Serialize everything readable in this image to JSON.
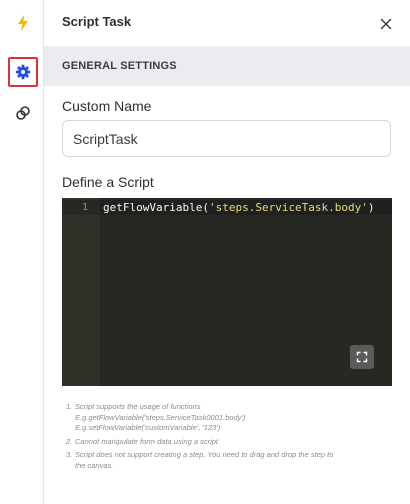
{
  "rail": {
    "items": [
      {
        "icon": "lightning-bolt-icon",
        "color": "#f5b800"
      },
      {
        "icon": "gear-icon",
        "color": "#1f4fd6",
        "selected": true
      },
      {
        "icon": "link-icon",
        "color": "#333333"
      }
    ]
  },
  "panel": {
    "title": "Script Task",
    "close_icon": "close-icon"
  },
  "section": {
    "title": "GENERAL SETTINGS"
  },
  "custom_name": {
    "label": "Custom Name",
    "value": "ScriptTask"
  },
  "script": {
    "label": "Define a Script",
    "line_number": "1",
    "code_func": "getFlowVariable(",
    "code_string": "'steps.ServiceTask.body'",
    "code_close": ")",
    "fullscreen_icon": "fullscreen-icon"
  },
  "notes": [
    {
      "num": "1.",
      "lines": [
        "Script supports the usage of functions",
        "E.g.getFlowVariable('steps.ServiceTask0001.body')",
        "E.g.setFlowVariable('customVariable', '123')"
      ]
    },
    {
      "num": "2.",
      "lines": [
        "Cannot manipulate form data using a script"
      ]
    },
    {
      "num": "3.",
      "lines": [
        "Script does not support creating a step, You need to drag and drop the step to",
        "the canvas."
      ]
    }
  ],
  "colors": {
    "accent_blue": "#1f4fd6",
    "selection_red": "#e0303a",
    "editor_bg": "#272822",
    "string_yellow": "#e6db74"
  }
}
